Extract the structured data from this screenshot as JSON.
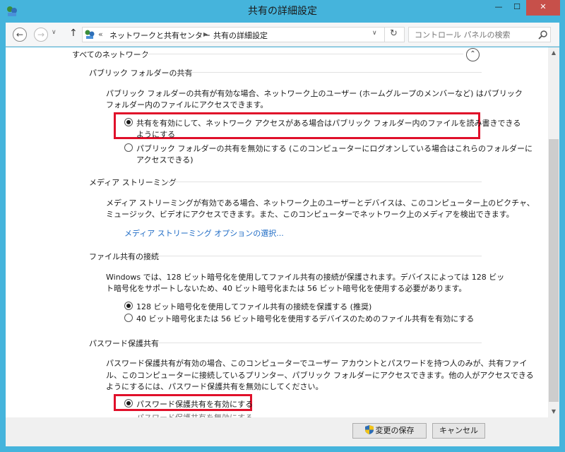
{
  "window": {
    "title": "共有の詳細設定",
    "min": "—",
    "max": "☐",
    "close": "✕"
  },
  "nav": {
    "back": "←",
    "forward": "→",
    "dropdown": "∨",
    "up": "↑",
    "chevrons": "«",
    "breadcrumb": [
      "ネットワークと共有センター",
      "共有の詳細設定"
    ],
    "crumb_separator": "▶",
    "address_dropdown": "∨",
    "refresh": "↻",
    "search_placeholder": "コントロール パネルの検索"
  },
  "content": {
    "group_title": "すべてのネットワーク",
    "collapse": "⌃",
    "public_folder": {
      "header": "パブリック フォルダーの共有",
      "desc_line1": "パブリック フォルダーの共有が有効な場合、ネットワーク上のユーザー (ホームグループのメンバーなど) はパブリック",
      "desc_line2": "フォルダー内のファイルにアクセスできます。",
      "option1_line1": "共有を有効にして、ネットワーク アクセスがある場合はパブリック フォルダー内のファイルを読み書きできる",
      "option1_line2": "ようにする",
      "option2_line1": "パブリック フォルダーの共有を無効にする (このコンピューターにログオンしている場合はこれらのフォルダーに",
      "option2_line2": "アクセスできる)"
    },
    "media_streaming": {
      "header": "メディア ストリーミング",
      "desc_line1": "メディア ストリーミングが有効である場合、ネットワーク上のユーザーとデバイスは、このコンピューター上のピクチャ、",
      "desc_line2": "ミュージック、ビデオにアクセスできます。また、このコンピューターでネットワーク上のメディアを検出できます。",
      "link": "メディア ストリーミング オプションの選択..."
    },
    "file_sharing": {
      "header": "ファイル共有の接続",
      "desc_line1": "Windows では、128 ビット暗号化を使用してファイル共有の接続が保護されます。デバイスによっては 128 ビッ",
      "desc_line2": "ト暗号化をサポートしないため、40 ビット暗号化または 56 ビット暗号化を使用する必要があります。",
      "option1": "128 ビット暗号化を使用してファイル共有の接続を保護する (推奨)",
      "option2": "40 ビット暗号化または 56 ビット暗号化を使用するデバイスのためのファイル共有を有効にする"
    },
    "password_sharing": {
      "header": "パスワード保護共有",
      "desc_line1": "パスワード保護共有が有効の場合、このコンピューターでユーザー アカウントとパスワードを持つ人のみが、共有ファイ",
      "desc_line2": "ル、このコンピューターに接続しているプリンター、パブリック フォルダーにアクセスできます。他の人がアクセスできる",
      "desc_line3": "ようにするには、パスワード保護共有を無効にしてください。",
      "option1": "パスワード保護共有を有効にする",
      "option2_partial": "パスワード保護共有を無効にする"
    }
  },
  "footer": {
    "save": "変更の保存",
    "cancel": "キャンセル"
  },
  "colors": {
    "title_bar": "#45b4dc",
    "close_button": "#c7504a",
    "highlight_box": "#e0102a",
    "link": "#1e6bc5"
  }
}
